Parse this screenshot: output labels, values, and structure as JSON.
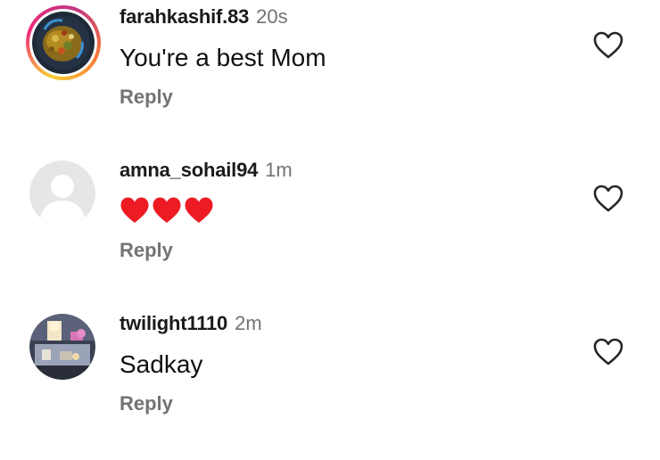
{
  "comments": [
    {
      "username": "farahkashif.83",
      "time": "20s",
      "text": "You're a best Mom",
      "reply_label": "Reply",
      "avatar": "food-photo-avatar",
      "has_story_ring": true,
      "like_icon": "heart-outline-icon"
    },
    {
      "username": "amna_sohail94",
      "time": "1m",
      "text": "",
      "emoji": [
        "red-heart-icon",
        "red-heart-icon",
        "red-heart-icon"
      ],
      "reply_label": "Reply",
      "avatar": "default-avatar",
      "has_story_ring": false,
      "like_icon": "heart-outline-icon"
    },
    {
      "username": "twilight1110",
      "time": "2m",
      "text": "Sadkay",
      "reply_label": "Reply",
      "avatar": "room-photo-avatar",
      "has_story_ring": false,
      "like_icon": "heart-outline-icon"
    }
  ],
  "colors": {
    "text": "#111111",
    "secondary": "#737373",
    "heart_red": "#ED1C24",
    "default_avatar_bg": "#E6E6E6"
  }
}
